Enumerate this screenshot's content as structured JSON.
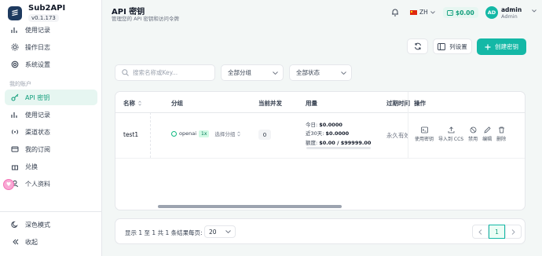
{
  "brand": {
    "name": "Sub2API",
    "version": "v0.1.173"
  },
  "sidebar": {
    "top_items": [
      {
        "label": "使用记录",
        "icon": "chart-icon"
      },
      {
        "label": "操作日志",
        "icon": "gear-icon"
      },
      {
        "label": "系统设置",
        "icon": "settings-icon"
      }
    ],
    "section_label": "我的账户",
    "account_items": [
      {
        "label": "API 密钥",
        "icon": "key-icon",
        "active": true
      },
      {
        "label": "使用记录",
        "icon": "chart-icon"
      },
      {
        "label": "渠道状态",
        "icon": "signal-icon"
      },
      {
        "label": "我的订阅",
        "icon": "card-icon"
      },
      {
        "label": "兑换",
        "icon": "gift-icon"
      },
      {
        "label": "个人资料",
        "icon": "user-icon"
      }
    ],
    "bottom_items": [
      {
        "label": "深色模式",
        "icon": "moon-icon"
      },
      {
        "label": "收起",
        "icon": "collapse-icon"
      }
    ]
  },
  "header": {
    "title": "API 密钥",
    "subtitle": "管理您的 API 密钥和访问令牌",
    "language": "ZH",
    "balance": "$0.00",
    "user": {
      "initials": "AD",
      "name": "admin",
      "role": "Admin"
    }
  },
  "toolbar": {
    "columns_label": "列设置",
    "create_label": "创建密钥"
  },
  "filters": {
    "search_placeholder": "搜索名称或Key...",
    "group_select": "全部分组",
    "status_select": "全部状态"
  },
  "table": {
    "headers": [
      "名称",
      "分组",
      "当前并发",
      "用量",
      "过期时间",
      "操作"
    ],
    "rows": [
      {
        "name": "test1",
        "group": "openai",
        "multiplier": "1x",
        "group_select": "选择分组",
        "concurrency": "0",
        "usage_today_label": "今日: ",
        "usage_today": "$0.0000",
        "usage_30d_label": "近30天: ",
        "usage_30d": "$0.0000",
        "quota_label": "额度: ",
        "quota": "$0.00 / $99999.00",
        "quota_used_fraction": 0,
        "expires": "永久有效",
        "actions": [
          "使用密钥",
          "导入到 CCS",
          "禁用",
          "编辑",
          "删除"
        ]
      }
    ]
  },
  "pagination": {
    "info": "显示 1 至 1 共 1 条结果",
    "per_page_label": "每页:",
    "per_page": "20",
    "current_page": "1"
  },
  "colors": {
    "accent": "#14b8a6",
    "accent_dark": "#0f9d7a",
    "active_bg": "#e6f6f1"
  }
}
